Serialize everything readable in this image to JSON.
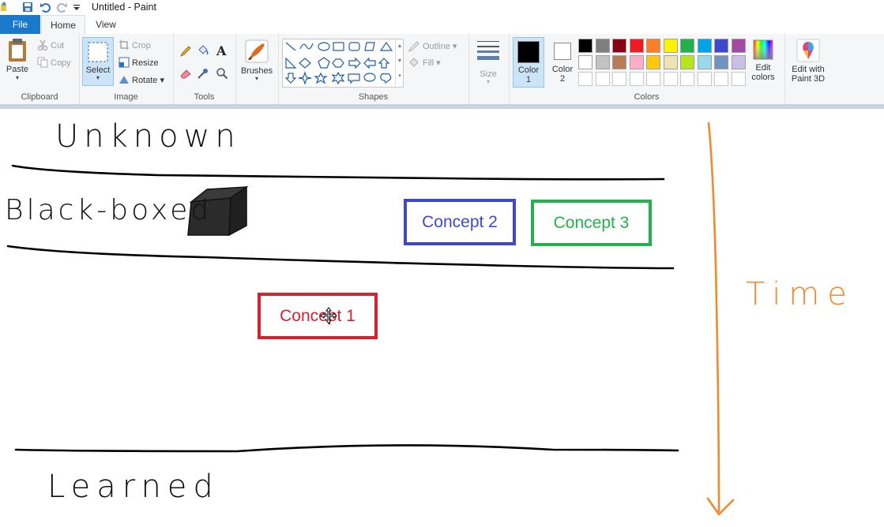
{
  "window": {
    "title": "Untitled - Paint"
  },
  "tabs": {
    "file": "File",
    "home": "Home",
    "view": "View"
  },
  "clipboard": {
    "paste": "Paste",
    "cut": "Cut",
    "copy": "Copy",
    "label": "Clipboard"
  },
  "image": {
    "select": "Select",
    "crop": "Crop",
    "resize": "Resize",
    "rotate": "Rotate",
    "label": "Image"
  },
  "tools": {
    "label": "Tools"
  },
  "brushes": {
    "label": "Brushes"
  },
  "shapes": {
    "outline": "Outline",
    "fill": "Fill",
    "label": "Shapes"
  },
  "size": {
    "label": "Size"
  },
  "colors": {
    "color1_label": "Color",
    "color1_num": "1",
    "color2_label": "Color",
    "color2_num": "2",
    "edit_colors_line1": "Edit",
    "edit_colors_line2": "colors",
    "label": "Colors",
    "color1": "#000000",
    "color2": "#ffffff",
    "palette_row1": [
      "#000000",
      "#7f7f7f",
      "#880015",
      "#ed1c24",
      "#ff7f27",
      "#fff200",
      "#22b14c",
      "#00a2e8",
      "#3f48cc",
      "#a349a4"
    ],
    "palette_row2": [
      "#ffffff",
      "#c3c3c3",
      "#b97a57",
      "#ffaec9",
      "#ffc90e",
      "#efe4b0",
      "#b5e61d",
      "#99d9ea",
      "#7092be",
      "#c8bfe7"
    ]
  },
  "paint3d": {
    "line1": "Edit with",
    "line2": "Paint 3D"
  },
  "drawing": {
    "unknown": "Unknown",
    "black_boxed": "Black-boxed",
    "learned": "Learned",
    "time": "Time",
    "concept1": "Concept 1",
    "concept2": "Concept 2",
    "concept3": "Concept 3",
    "concept1_color": "#d2232f",
    "concept2_color": "#3f48cc",
    "concept3_color": "#22b14c",
    "time_color": "#f08a30"
  }
}
